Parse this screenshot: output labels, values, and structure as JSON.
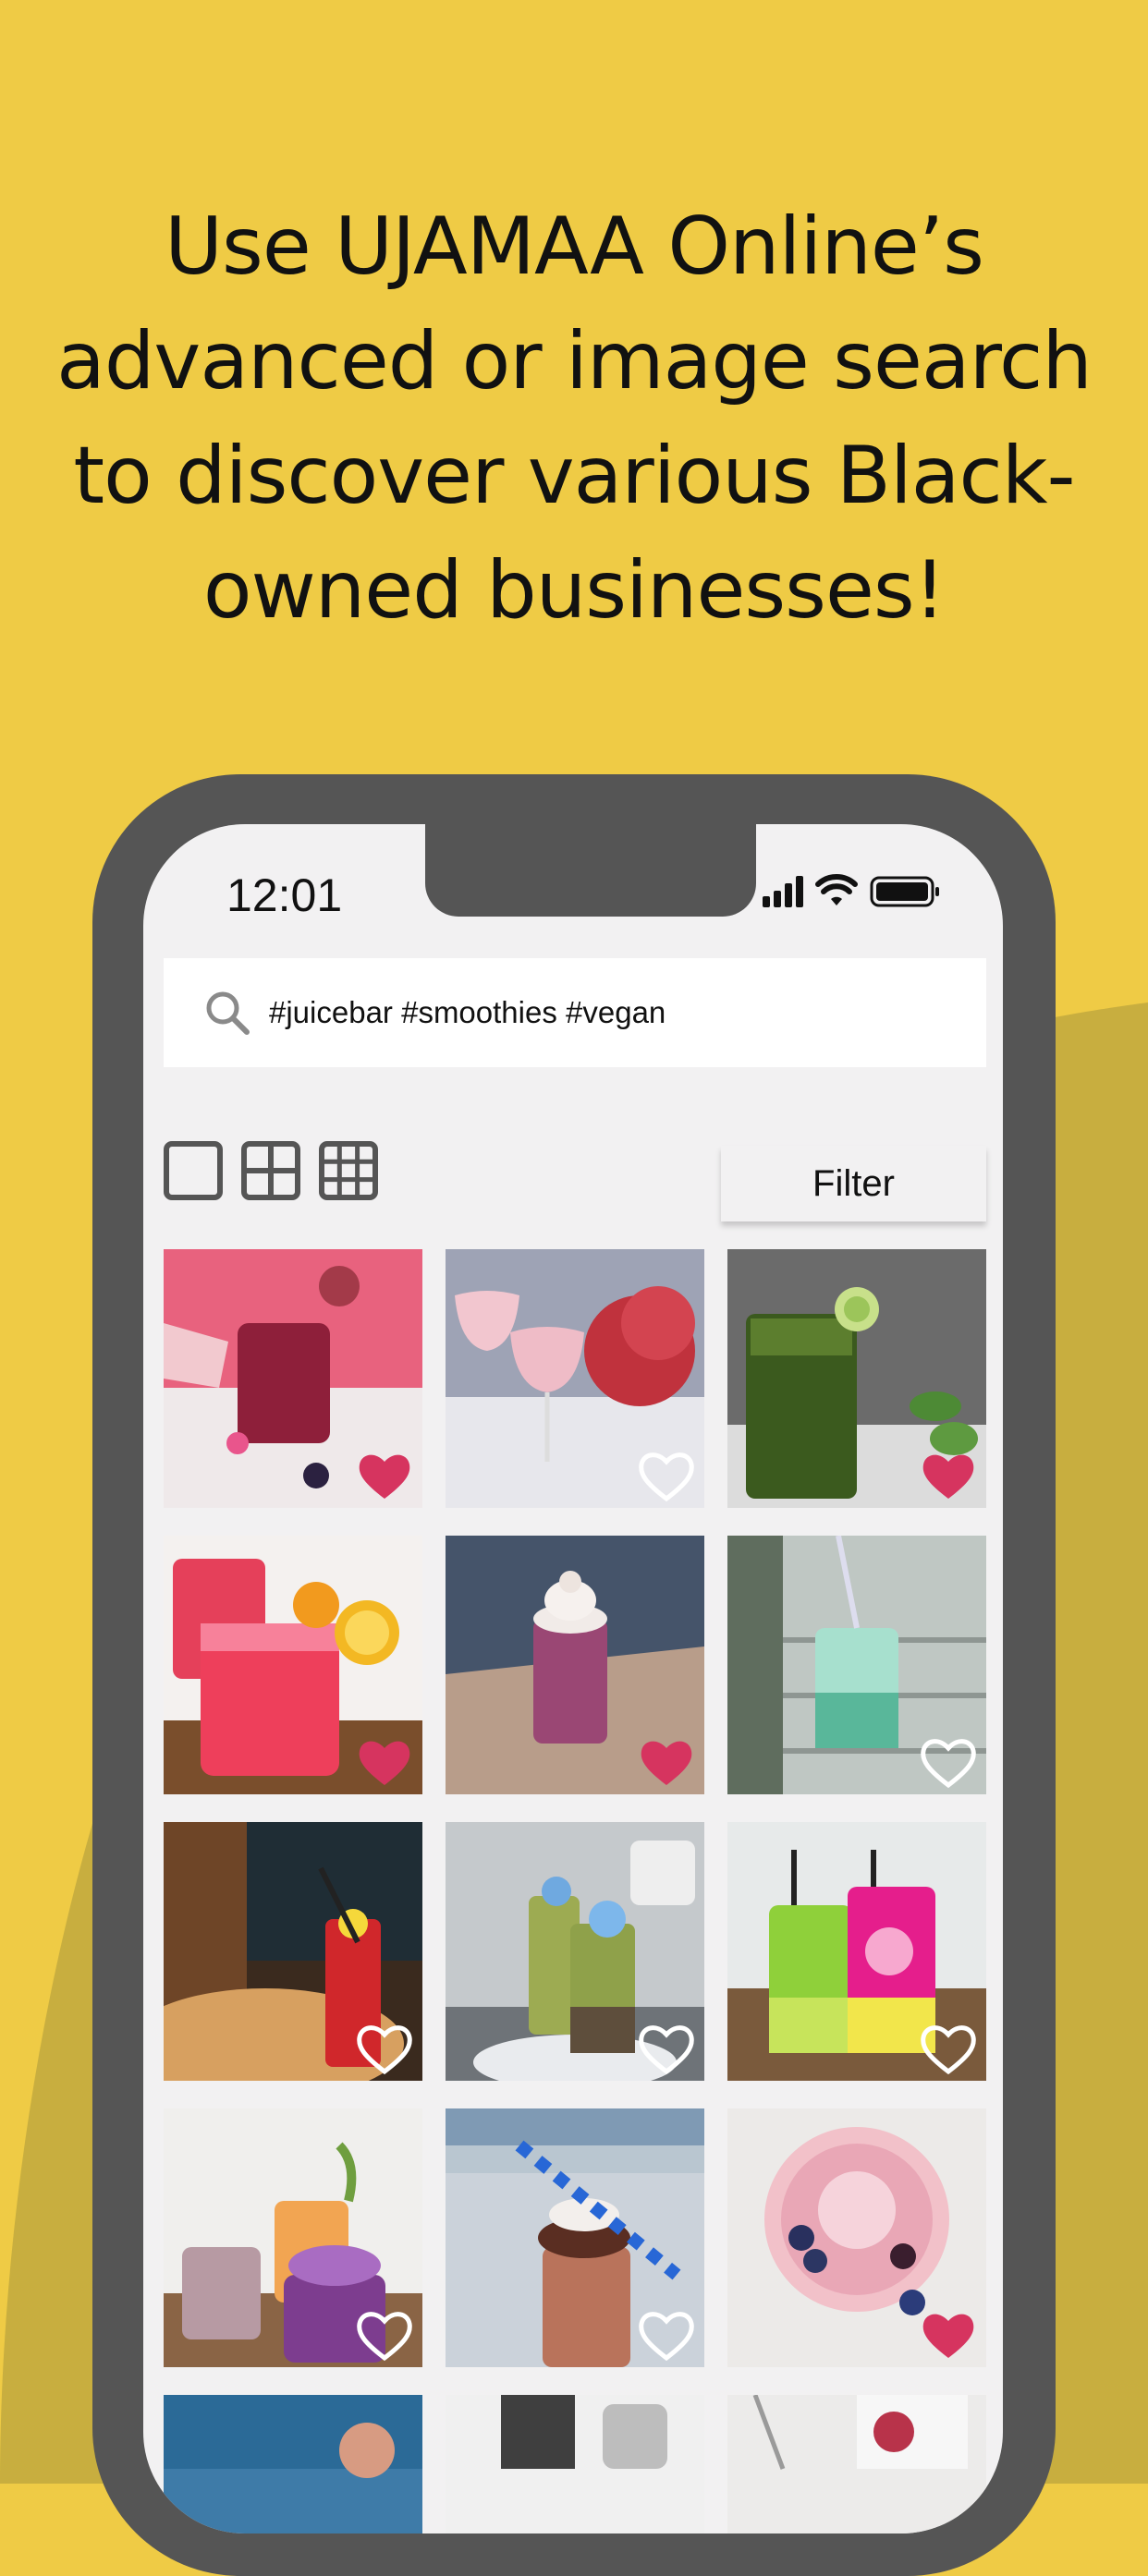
{
  "headline": {
    "line1": "Use UJAMAA Online’s",
    "line2": "advanced or image search",
    "line3": "to discover various Black-",
    "line4": "owned businesses!"
  },
  "colors": {
    "background": "#EFCB45",
    "accent_shape": "#C8AE3F",
    "phone_frame": "#555555",
    "screen": "#F2F1F2",
    "heart_liked": "#D6345F",
    "heart_outline": "#FFFFFF"
  },
  "status_bar": {
    "time": "12:01",
    "icons": [
      "cellular-signal-icon",
      "wifi-icon",
      "battery-icon"
    ]
  },
  "search": {
    "icon": "search-icon",
    "query": "#juicebar #smoothies #vegan"
  },
  "toolbar": {
    "view_options": [
      "single-column-view-icon",
      "two-column-grid-icon",
      "three-column-grid-icon"
    ],
    "filter_label": "Filter"
  },
  "tiles": [
    {
      "subject": "dragon fruit juice",
      "liked": true
    },
    {
      "subject": "strawberry smoothie glasses",
      "liked": false
    },
    {
      "subject": "green cucumber juice",
      "liked": true
    },
    {
      "subject": "watermelon lemon drink",
      "liked": true
    },
    {
      "subject": "berry milkshake",
      "liked": true
    },
    {
      "subject": "mint green drink",
      "liked": false
    },
    {
      "subject": "red iced drink",
      "liked": false
    },
    {
      "subject": "matcha smoothies",
      "liked": false
    },
    {
      "subject": "juice bar cups",
      "liked": false
    },
    {
      "subject": "fruit smoothie jars",
      "liked": false
    },
    {
      "subject": "chocolate milkshake",
      "liked": false
    },
    {
      "subject": "smoothie bowl",
      "liked": true
    },
    {
      "subject": "blue background drink",
      "liked": false
    },
    {
      "subject": "drink photo",
      "liked": false
    },
    {
      "subject": "berry dessert",
      "liked": false
    }
  ]
}
